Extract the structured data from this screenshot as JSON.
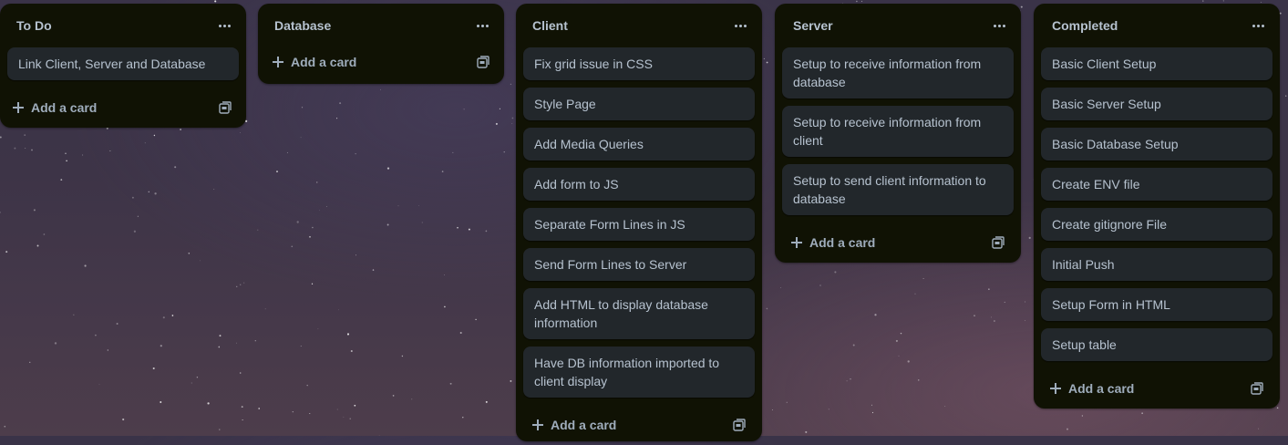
{
  "board": {
    "add_card_label": "Add a card",
    "menu_icon": "more-horizontal-icon",
    "template_icon": "card-template-icon",
    "lists": [
      {
        "title": "To Do",
        "cards": [
          "Link Client, Server and Database"
        ]
      },
      {
        "title": "Database",
        "cards": []
      },
      {
        "title": "Client",
        "cards": [
          "Fix grid issue in CSS",
          "Style Page",
          "Add Media Queries",
          "Add form to JS",
          "Separate Form Lines in JS",
          "Send Form Lines to Server",
          "Add HTML to display database information",
          "Have DB information imported to client display"
        ]
      },
      {
        "title": "Server",
        "cards": [
          "Setup to receive information from database",
          "Setup to receive information from client",
          "Setup to send client information to database"
        ]
      },
      {
        "title": "Completed",
        "cards": [
          "Basic Client Setup",
          "Basic Server Setup",
          "Basic Database Setup",
          "Create ENV file",
          "Create gitignore File",
          "Initial Push",
          "Setup Form in HTML",
          "Setup table"
        ]
      }
    ]
  }
}
